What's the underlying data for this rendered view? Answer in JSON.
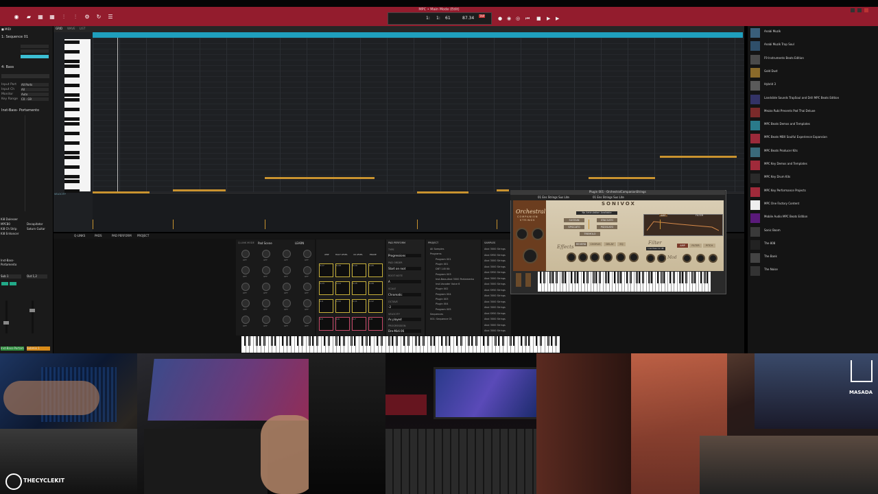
{
  "window": {
    "title": "MPC • Main Mode (Edit)"
  },
  "transport": {
    "bars": "1:",
    "beats": "1:",
    "ticks": "61",
    "bpm": "87.34",
    "tap": "TAP"
  },
  "left_panel": {
    "sequence": "1: Sequence 01",
    "track": "4: Bass",
    "fields": [
      {
        "label": "Input Port",
        "value": "All Ports"
      },
      {
        "label": "Input Ch",
        "value": "All"
      },
      {
        "label": "Monitor",
        "value": "Auto"
      },
      {
        "label": "Key Range",
        "value": "C0 - G9"
      }
    ],
    "program": "Inst-Bass- Portamento",
    "channels": [
      "Ki8 Dulesser",
      "MPCB0",
      "Ki8 Ch Strip",
      "Ki8 Enhancer"
    ],
    "inserts": [
      "Decapitator",
      "Saturn Guitar"
    ],
    "strip_name": "Inst-Bass-Portamento",
    "bottom_tags": [
      "Inst-Bass-Portam",
      "Submix 1"
    ],
    "outs": [
      "Sub 1",
      "Out 1,2"
    ]
  },
  "editor": {
    "tabs": [
      "GRID",
      "WAVE",
      "LIST"
    ],
    "velocity_label": "VELOCITY",
    "notes": [
      [
        135,
        279,
        218
      ],
      [
        252,
        276,
        329
      ],
      [
        386,
        258,
        546
      ],
      [
        608,
        279,
        683
      ],
      [
        724,
        276,
        742
      ],
      [
        858,
        258,
        955
      ],
      [
        962,
        227,
        1074
      ]
    ]
  },
  "lower_tabs": [
    "Q-LINKS",
    "PADS",
    "PAD PERFORM",
    "PROJECT"
  ],
  "qlink": {
    "mode_label": "Q-LINK MODE",
    "mode_value": "Pad Scene",
    "learn": "LEARN",
    "knob_label": "OFF"
  },
  "pads": {
    "header": [
      "AMP",
      "HALF LEVEL",
      "16 LEVEL",
      "ERASE"
    ],
    "labels": [
      "0-17\nClash 01",
      "0-18\nClash 02",
      "0-19\nClash 03",
      "0-20\nClash 04",
      "0-13",
      "0-14",
      "0-15",
      "0-16",
      "0-9",
      "0-10",
      "0-11",
      "0-12",
      "0-5",
      "0-6",
      "0-7",
      "0-8"
    ]
  },
  "pad_perform": {
    "title": "PAD PERFORM",
    "type_label": "TYPE",
    "type_value": "Progressions",
    "order_label": "PAD ORDER",
    "order_value": "Start on root",
    "root_label": "ROOT NOTE",
    "root_value": "A",
    "scale_label": "SCALE",
    "scale_value": "Chromatic",
    "octave_label": "OCTAVE",
    "octave_value": "-2",
    "velocity_label": "VELOCITY",
    "velocity_value": "As played",
    "prog_label": "PROGRESSION",
    "prog_value": "Dre-Midi 06"
  },
  "project": {
    "title": "PROJECT",
    "items": [
      "All Samples",
      "Programs",
      "Program 001",
      "Plugin 001",
      "DBT 145 Kit",
      "Program 003",
      "Inst-Bass-Akai 3000 Portamento",
      "Inst-Vocoder Voice 6",
      "Plugin 002",
      "Program 004",
      "Plugin 003",
      "Plugin 004",
      "Program 005",
      "Sequences",
      "001: Sequence 01"
    ]
  },
  "samples": {
    "title": "SAMPLES",
    "items": [
      "Akai 3000 Strings",
      "Akai S950 Strings",
      "Akai 3000 Strings",
      "Akai 3000 Strings",
      "Akai S950 Strings",
      "Akai 3000 Strings",
      "Akai 3000 Strings",
      "Akai S950 Strings",
      "Akai 3000 Strings",
      "Akai 3000 Strings",
      "Akai 3000 Strings",
      "Akai S950 Strings",
      "Akai 3000 Strings",
      "Akai 3000 Strings",
      "Akai 3000 Strings"
    ]
  },
  "plugin": {
    "title": "Plugin 001 - OrchestralCompanionStrings",
    "preset": "01 Ens Strings Sus Lite",
    "brand": "SONIVOX",
    "logo": "Orchestral",
    "logo_sub": "COMPANION",
    "logo_sub2": "STRINGS",
    "articulations": [
      "SUSTAIN",
      "STACCATO",
      "SPICCATO",
      "PIZZICATO",
      "TREMOLO"
    ],
    "no_articulation": "No Articulation Available",
    "effects_label": "Effects",
    "fx_tabs": [
      "REVERB",
      "CHORUS",
      "DELAY",
      "EQ"
    ],
    "filter_label": "Filter",
    "lfo_label": "LFO Mod",
    "filter_type": "Low Pass 12 dB",
    "amp_tabs": [
      "AMP",
      "FILTER"
    ],
    "amp_tabs2": [
      "AMP",
      "FILTER",
      "PITCH"
    ],
    "amp_knobs": [
      "attack",
      "hold",
      "decay",
      "sustain",
      "release"
    ],
    "side_labels": [
      "tone",
      "bodyrate",
      "volume"
    ]
  },
  "browser": {
    "items": [
      {
        "title": "Anabi Muzik",
        "color": "#3a5f7a"
      },
      {
        "title": "Anabi Muzik Trap Soul",
        "color": "#2f4f6a"
      },
      {
        "title": "F9 Instruments Beats Edition",
        "color": "#4a4a4a"
      },
      {
        "title": "Gold Dust",
        "color": "#8a6a2a"
      },
      {
        "title": "Hybrid 3",
        "color": "#5a5a5a"
      },
      {
        "title": "Landslide Sounds TrapSoul and Drill MPC Beats Edition",
        "color": "#336"
      },
      {
        "title": "Mezzo Rubi Presents Pad Thai Deluxe",
        "color": "#7a2a2a"
      },
      {
        "title": "MPC Beats Demos and Templates",
        "color": "#2a7a8a"
      },
      {
        "title": "MPC Beats MBX Soulful Experience Expansion",
        "color": "#9a2a3a"
      },
      {
        "title": "MPC Beats Producer Kits",
        "color": "#3a6a7a"
      },
      {
        "title": "MPC Key Demos and Templates",
        "color": "#a02a3a"
      },
      {
        "title": "MPC Key Drum Kits",
        "color": "#2a2a2a"
      },
      {
        "title": "MPC Key Performance Projects",
        "color": "#a02a3a"
      },
      {
        "title": "MPC One Factory Content",
        "color": "#eeeeee"
      },
      {
        "title": "Mobile Audio MPC Beats Edition",
        "color": "#5a1a7a"
      },
      {
        "title": "Sonic Boom",
        "color": "#3a3a3a"
      },
      {
        "title": "The 808",
        "color": "#222"
      },
      {
        "title": "The Bank",
        "color": "#444"
      },
      {
        "title": "The Noise",
        "color": "#333"
      }
    ]
  },
  "watermarks": {
    "left": "THECYCLEKIT",
    "right": "MASADA"
  }
}
